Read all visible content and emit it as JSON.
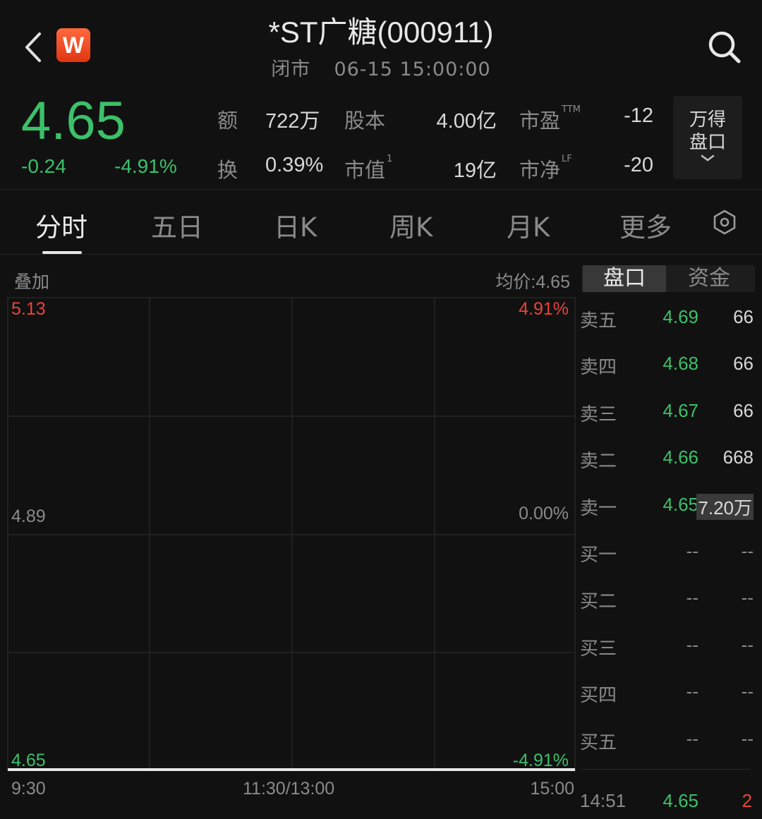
{
  "header": {
    "title": "*ST广糖(000911)",
    "status": "闭市",
    "datetime": "06-15 15:00:00",
    "logo_letter": "W"
  },
  "quote": {
    "price": "4.65",
    "change": "-0.24",
    "change_pct": "-4.91%",
    "stats": [
      {
        "label": "额",
        "value": "722万"
      },
      {
        "label": "换",
        "value": "0.39%"
      },
      {
        "label": "股本",
        "value": "4.00亿"
      },
      {
        "label": "市值",
        "sup": "1",
        "value": "19亿"
      },
      {
        "label": "市盈",
        "sup": "TTM",
        "value": "-12"
      },
      {
        "label": "市净",
        "sup": "LF",
        "value": "-20"
      }
    ],
    "wind_panel": {
      "line1": "万得",
      "line2": "盘口"
    }
  },
  "tabs": [
    "分时",
    "五日",
    "日K",
    "周K",
    "月K",
    "更多"
  ],
  "active_tab": "分时",
  "chart": {
    "overlay_label": "叠加",
    "avg_price": "均价:4.65",
    "y_high": "5.13",
    "y_mid": "4.89",
    "y_low": "4.65",
    "pct_high": "4.91%",
    "pct_mid": "0.00%",
    "pct_low": "-4.91%",
    "x_start": "9:30",
    "x_mid": "11:30/13:00",
    "x_end": "15:00"
  },
  "chart_data": {
    "type": "line",
    "title": "",
    "xlabel": "",
    "ylabel": "",
    "x": [
      "9:30",
      "11:30/13:00",
      "15:00"
    ],
    "series": [
      {
        "values": [
          4.65,
          4.65,
          4.65
        ]
      }
    ],
    "ylim": [
      4.65,
      5.13
    ],
    "grid": true
  },
  "order_book": {
    "tabs": [
      "盘口",
      "资金"
    ],
    "asks": [
      {
        "label": "卖五",
        "price": "4.69",
        "vol": "66"
      },
      {
        "label": "卖四",
        "price": "4.68",
        "vol": "66"
      },
      {
        "label": "卖三",
        "price": "4.67",
        "vol": "66"
      },
      {
        "label": "卖二",
        "price": "4.66",
        "vol": "668"
      },
      {
        "label": "卖一",
        "price": "4.65",
        "vol": "7.20万"
      }
    ],
    "bids": [
      {
        "label": "买一",
        "price": "--",
        "vol": "--"
      },
      {
        "label": "买二",
        "price": "--",
        "vol": "--"
      },
      {
        "label": "买三",
        "price": "--",
        "vol": "--"
      },
      {
        "label": "买四",
        "price": "--",
        "vol": "--"
      },
      {
        "label": "买五",
        "price": "--",
        "vol": "--"
      }
    ],
    "last_trade": {
      "time": "14:51",
      "price": "4.65",
      "vol": "2"
    }
  },
  "colors": {
    "up": "#e8443a",
    "down": "#3cc06a",
    "background": "#111111"
  }
}
